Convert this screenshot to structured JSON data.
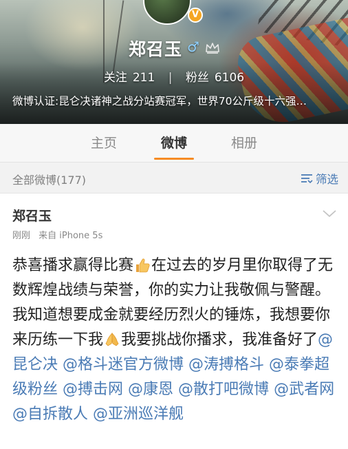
{
  "profile": {
    "name": "郑召玉",
    "verified_mark": "V",
    "gender_symbol": "♂",
    "following_label": "关注",
    "following_count": "211",
    "divider": "|",
    "followers_label": "粉丝",
    "followers_count": "6106",
    "verification": "微博认证:昆仑决诸神之战分站赛冠军，世界70公斤级十六强…"
  },
  "tabs": [
    {
      "label": "主页",
      "active": false
    },
    {
      "label": "微博",
      "active": true
    },
    {
      "label": "相册",
      "active": false
    }
  ],
  "filter": {
    "title": "全部微博(177)",
    "button_label": "筛选"
  },
  "post": {
    "author": "郑召玉",
    "time": "刚刚",
    "source": "来自 iPhone 5s",
    "text_1": "恭喜播求赢得比赛",
    "emoji_1": "thumbs-up-emoji",
    "text_2": "在过去的岁月里你取得了无数辉煌战绩与荣誉，你的实力让我敬佩与警醒。我知道想要成金就要经历烈火的锤炼，我想要你来历练一下我",
    "emoji_2": "praying-hands-emoji",
    "text_3": "我要挑战你播求，我准备好了",
    "mentions": [
      "@昆仑决",
      "@格斗迷官方微博",
      "@涛搏格斗",
      "@泰拳超级粉丝",
      "@搏击网",
      "@康恩",
      "@散打吧微博",
      "@武者网",
      "@自拆散人",
      "@亚洲巡洋舰"
    ]
  },
  "colors": {
    "accent": "#f68b24",
    "link": "#4a7bb5",
    "verified_badge": "#f5a623"
  }
}
